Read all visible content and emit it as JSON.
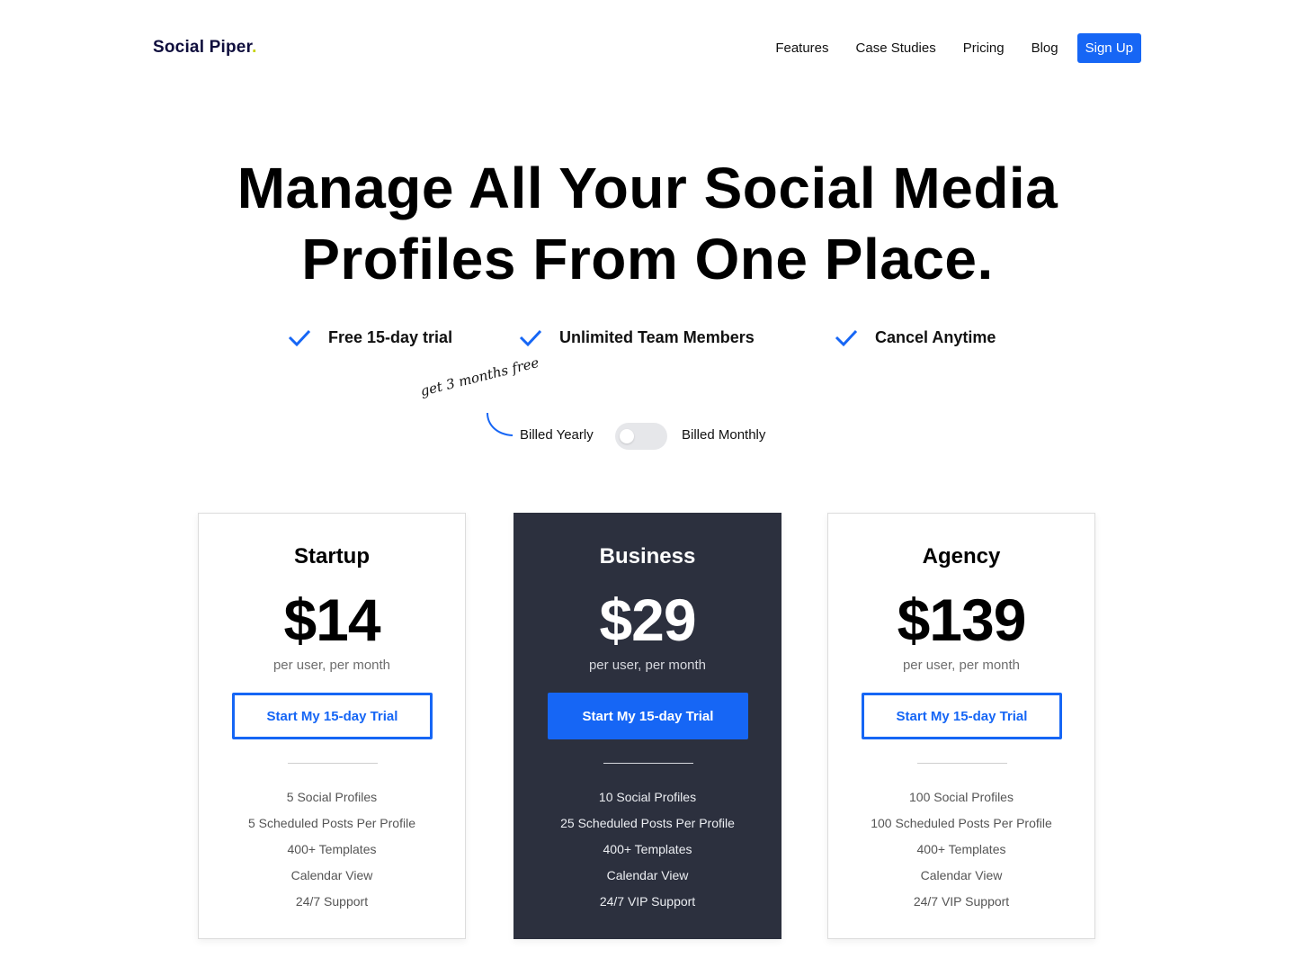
{
  "brand": {
    "name": "Social Piper",
    "dot": ".",
    "dot_color": "#c6d300"
  },
  "nav": {
    "items": [
      {
        "label": "Features"
      },
      {
        "label": "Case Studies"
      },
      {
        "label": "Pricing"
      },
      {
        "label": "Blog"
      }
    ],
    "signup_label": "Sign Up"
  },
  "hero": {
    "line1": "Manage All Your Social Media",
    "line2": "Profiles From One Place."
  },
  "perks": [
    {
      "label": "Free 15-day trial",
      "icon": "check-icon"
    },
    {
      "label": "Unlimited Team Members",
      "icon": "check-icon"
    },
    {
      "label": "Cancel Anytime",
      "icon": "check-icon"
    }
  ],
  "billing": {
    "promo": "get 3 months free",
    "yearly_label": "Billed Yearly",
    "monthly_label": "Billed Monthly",
    "toggle_state": "yearly"
  },
  "plans": [
    {
      "name": "Startup",
      "price": "$14",
      "per": "per user, per month",
      "cta": "Start My 15-day Trial",
      "features": [
        "5 Social Profiles",
        "5 Scheduled Posts Per Profile",
        "400+ Templates",
        "Calendar View",
        "24/7 Support"
      ]
    },
    {
      "name": "Business",
      "price": "$29",
      "per": "per user, per month",
      "cta": "Start My 15-day Trial",
      "features": [
        "10 Social Profiles",
        "25 Scheduled Posts Per Profile",
        "400+ Templates",
        "Calendar View",
        "24/7 VIP Support"
      ]
    },
    {
      "name": "Agency",
      "price": "$139",
      "per": "per user, per month",
      "cta": "Start My 15-day Trial",
      "features": [
        "100 Social Profiles",
        "100 Scheduled Posts Per Profile",
        "400+ Templates",
        "Calendar View",
        "24/7 VIP Support"
      ]
    }
  ],
  "colors": {
    "accent": "#1666f5",
    "dark_card": "#2c303e"
  }
}
